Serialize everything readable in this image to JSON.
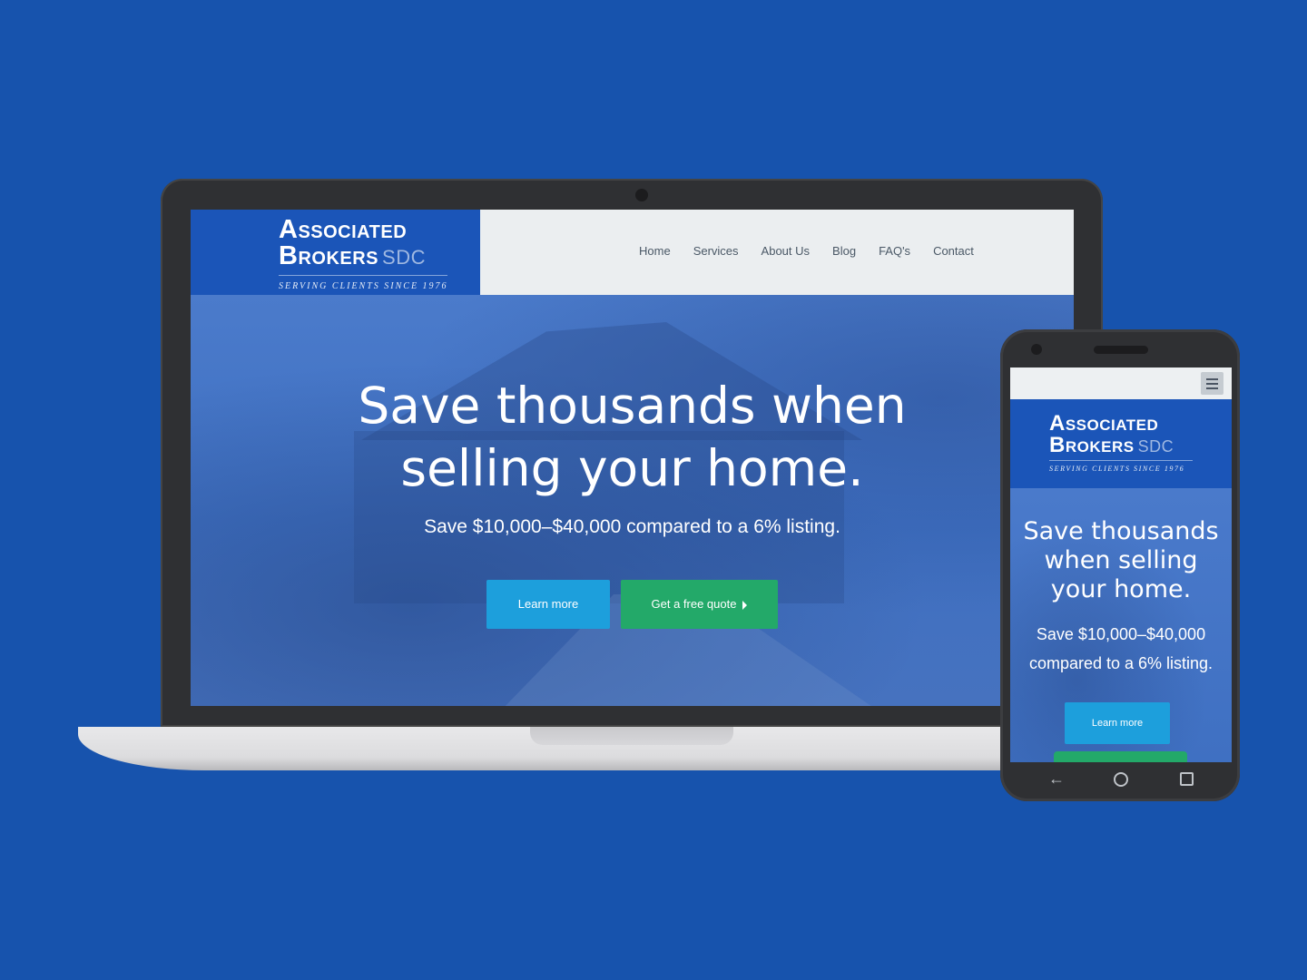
{
  "brand": {
    "line1": "Associated",
    "line2": "Brokers",
    "suffix": "SDC",
    "tagline": "SERVING CLIENTS SINCE 1976"
  },
  "nav": {
    "items": [
      {
        "label": "Home"
      },
      {
        "label": "Services"
      },
      {
        "label": "About Us"
      },
      {
        "label": "Blog"
      },
      {
        "label": "FAQ's"
      },
      {
        "label": "Contact"
      }
    ]
  },
  "hero": {
    "headline_desktop": [
      "Save thousands when",
      "selling your home."
    ],
    "headline_mobile": [
      "Save thousands",
      "when selling",
      "your home."
    ],
    "subtext": "Save $10,000–$40,000 compared to a 6% listing.",
    "subtext_mobile": [
      "Save $10,000–$40,000",
      "compared to a 6% listing."
    ],
    "learn_more_label": "Learn more",
    "quote_label": "Get a free quote"
  },
  "colors": {
    "background": "#1753ad",
    "brand_blue": "#1b55b8",
    "button_blue": "#1d9fdc",
    "button_green": "#23a969"
  },
  "icons": {
    "mobile_menu": "hamburger-icon",
    "quote_arrow": "caret-right-icon",
    "android_back": "back-arrow-icon",
    "android_home": "circle-home-icon",
    "android_recents": "square-recents-icon"
  }
}
